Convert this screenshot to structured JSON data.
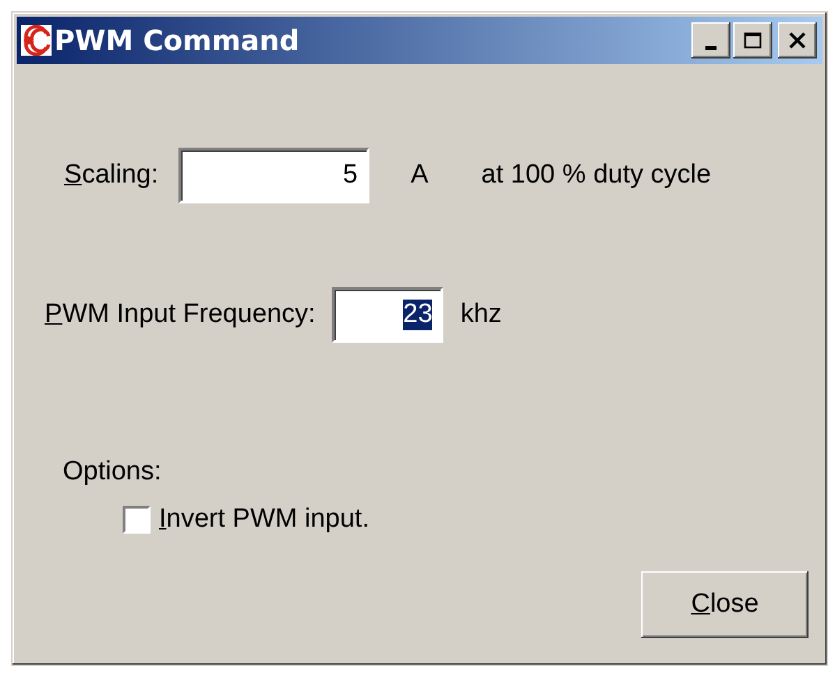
{
  "window": {
    "title": "PWM Command"
  },
  "scaling": {
    "label": {
      "key": "S",
      "rest": "caling:"
    },
    "value": "5",
    "unit": "A",
    "note": "at 100 % duty cycle"
  },
  "frequency": {
    "label": {
      "key": "P",
      "rest": "WM Input Frequency:"
    },
    "value": "23",
    "value_selected": true,
    "unit": "khz"
  },
  "options": {
    "label": "Options:",
    "items": [
      {
        "label": {
          "key": "I",
          "rest": "nvert PWM input."
        },
        "checked": false
      }
    ]
  },
  "buttons": [
    {
      "label": {
        "key": "C",
        "rest": "lose"
      }
    }
  ]
}
